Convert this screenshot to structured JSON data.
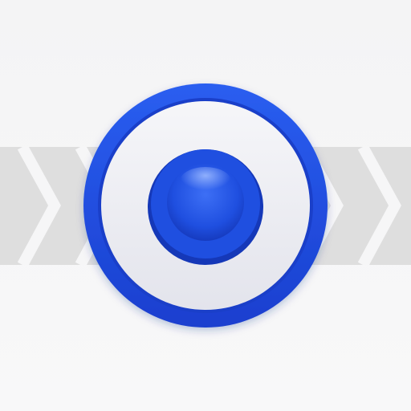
{
  "icon": {
    "name": "record-button-app-icon",
    "colors": {
      "background": "#f6f6f7",
      "band": "#dedede",
      "chevron_stroke": "#f6f6f7",
      "ring_blue": "#1f4fe0",
      "ring_blue_dark": "#1738c4",
      "inner_face": "#ecedf2",
      "dot_blue": "#2155e6",
      "dot_highlight": "#6f98ff"
    }
  }
}
